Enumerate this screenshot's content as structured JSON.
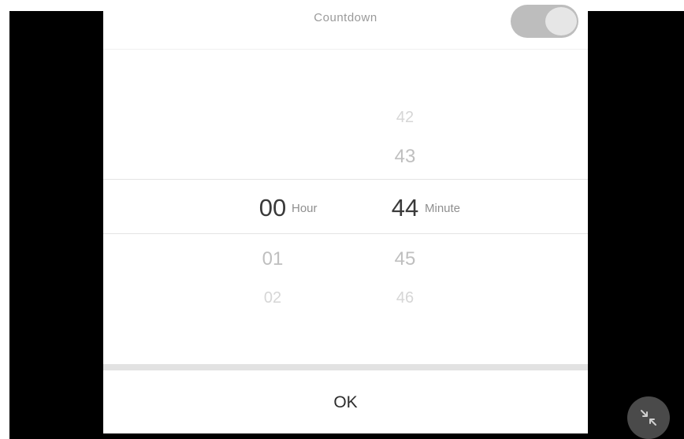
{
  "dialog": {
    "title": "Countdown",
    "toggle_on": true,
    "ok_label": "OK"
  },
  "picker": {
    "hour": {
      "unit": "Hour",
      "selected": "00",
      "after": [
        "01",
        "02"
      ]
    },
    "minute": {
      "unit": "Minute",
      "before": [
        "42",
        "43"
      ],
      "selected": "44",
      "after": [
        "45",
        "46"
      ]
    }
  },
  "icons": {
    "fab_icon": "collapse-arrows-icon"
  },
  "colors": {
    "background": "#000000",
    "dialog": "#ffffff",
    "selected_text": "#3a3a3a",
    "fab": "#4a4a4a"
  }
}
